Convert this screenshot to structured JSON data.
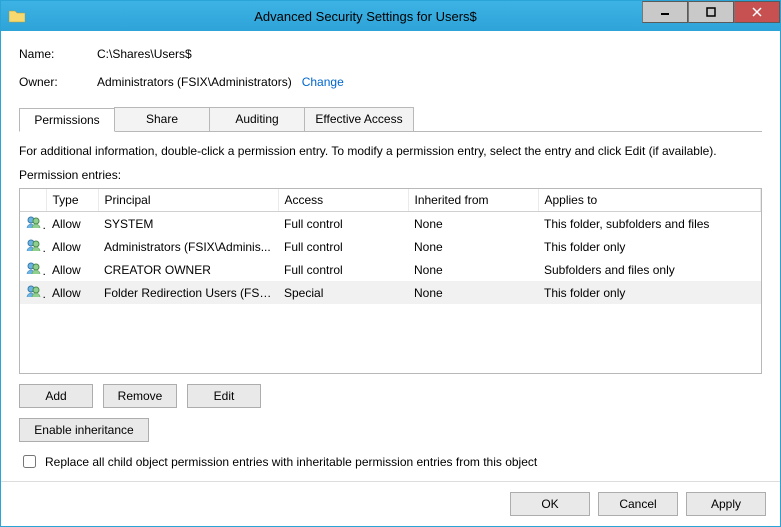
{
  "window": {
    "title": "Advanced Security Settings for Users$"
  },
  "fields": {
    "name_label": "Name:",
    "name_value": "C:\\Shares\\Users$",
    "owner_label": "Owner:",
    "owner_value": "Administrators (FSIX\\Administrators)",
    "change_link": "Change"
  },
  "tabs": {
    "permissions": "Permissions",
    "share": "Share",
    "auditing": "Auditing",
    "effective": "Effective Access"
  },
  "panel": {
    "help": "For additional information, double-click a permission entry. To modify a permission entry, select the entry and click Edit (if available).",
    "entries_label": "Permission entries:"
  },
  "columns": {
    "type": "Type",
    "principal": "Principal",
    "access": "Access",
    "inherited": "Inherited from",
    "applies": "Applies to"
  },
  "rows": [
    {
      "type": "Allow",
      "principal": "SYSTEM",
      "access": "Full control",
      "inherited": "None",
      "applies": "This folder, subfolders and files"
    },
    {
      "type": "Allow",
      "principal": "Administrators (FSIX\\Adminis...",
      "access": "Full control",
      "inherited": "None",
      "applies": "This folder only"
    },
    {
      "type": "Allow",
      "principal": "CREATOR OWNER",
      "access": "Full control",
      "inherited": "None",
      "applies": "Subfolders and files only"
    },
    {
      "type": "Allow",
      "principal": "Folder Redirection Users (FSIX...",
      "access": "Special",
      "inherited": "None",
      "applies": "This folder only"
    }
  ],
  "buttons": {
    "add": "Add",
    "remove": "Remove",
    "edit": "Edit",
    "enable_inherit": "Enable inheritance",
    "ok": "OK",
    "cancel": "Cancel",
    "apply": "Apply"
  },
  "checkbox": {
    "replace_label": "Replace all child object permission entries with inheritable permission entries from this object"
  }
}
